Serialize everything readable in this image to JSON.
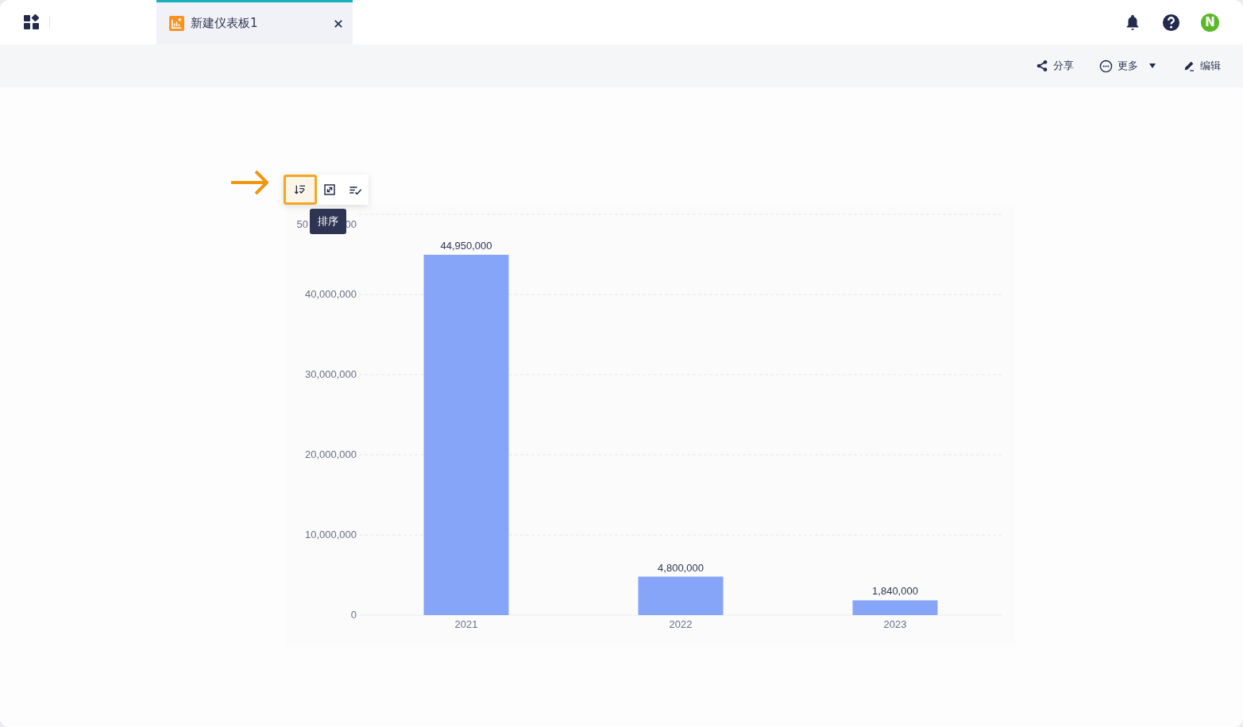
{
  "tabs": [
    {
      "label": "新建仪表板1",
      "selected": true
    }
  ],
  "toolbar": [
    {
      "kind": "share",
      "label": "分享"
    },
    {
      "kind": "more",
      "label": "更多"
    },
    {
      "kind": "edit",
      "label": "编辑"
    }
  ],
  "avatar": {
    "initial": "N"
  },
  "chart_tools": [
    {
      "kind": "sort",
      "selected": true
    },
    {
      "kind": "expand",
      "selected": false
    },
    {
      "kind": "filter",
      "selected": false
    }
  ],
  "tooltip": "排序",
  "chart": {
    "chart_data": {
      "type": "bar",
      "categories": [
        "2021",
        "2022",
        "2023"
      ],
      "series": [
        {
          "color": "#86a5f8",
          "values": [
            44950000,
            4800000,
            1840000
          ]
        }
      ],
      "ylim": [
        0,
        50000000
      ],
      "yticks": [
        {
          "value": 0,
          "label": "0"
        },
        {
          "value": 10000000,
          "label": "10,000,000"
        },
        {
          "value": 20000000,
          "label": "20,000,000"
        },
        {
          "value": 30000000,
          "label": "30,000,000"
        },
        {
          "value": 40000000,
          "label": "40,000,000"
        }
      ],
      "grid": true,
      "value_labels": [
        "44,950,000",
        "4,800,000",
        "1,840,000"
      ]
    },
    "top_tick_fragments": [
      "50",
      "00"
    ]
  }
}
